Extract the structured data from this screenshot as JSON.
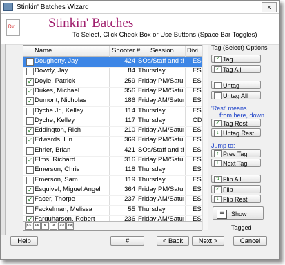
{
  "window": {
    "title": "Stinkin' Batches Wizard",
    "close": "x"
  },
  "header": {
    "logo_text": "Rur",
    "title": "Stinkin' Batches",
    "subtitle": "To Select, Click Check Box or Use Buttons  (Space Bar Toggles)"
  },
  "columns": {
    "name": "Name",
    "shooter": "Shooter #",
    "session": "Session",
    "division": "Divi"
  },
  "rows": [
    {
      "checked": false,
      "selected": true,
      "name": "Dougherty, Jay",
      "shooter": "424",
      "session": "SOs/Staff and th",
      "division": "ES"
    },
    {
      "checked": false,
      "selected": false,
      "name": "Dowdy, Jay",
      "shooter": "84",
      "session": "Thursday",
      "division": "ES"
    },
    {
      "checked": true,
      "selected": false,
      "name": "Doyle, Patrick",
      "shooter": "259",
      "session": "Friday PM/Saturd",
      "division": "ES"
    },
    {
      "checked": true,
      "selected": false,
      "name": "Dukes, Michael",
      "shooter": "356",
      "session": "Friday PM/Saturd",
      "division": "ES"
    },
    {
      "checked": true,
      "selected": false,
      "name": "Dumont, Nicholas",
      "shooter": "186",
      "session": "Friday AM/Saturd",
      "division": "ES"
    },
    {
      "checked": false,
      "selected": false,
      "name": "Dyche Jr., Kelley",
      "shooter": "114",
      "session": "Thursday",
      "division": "ES"
    },
    {
      "checked": false,
      "selected": false,
      "name": "Dyche, Kelley",
      "shooter": "117",
      "session": "Thursday",
      "division": "CD"
    },
    {
      "checked": true,
      "selected": false,
      "name": "Eddington, Rich",
      "shooter": "210",
      "session": "Friday AM/Saturd",
      "division": "ES"
    },
    {
      "checked": true,
      "selected": false,
      "name": "Edwards, Lin",
      "shooter": "369",
      "session": "Friday PM/Saturd",
      "division": "ES"
    },
    {
      "checked": false,
      "selected": false,
      "name": "Ehrler, Brian",
      "shooter": "421",
      "session": "SOs/Staff and th",
      "division": "ES"
    },
    {
      "checked": true,
      "selected": false,
      "name": "Elms, Richard",
      "shooter": "316",
      "division": "ES",
      "session": "Friday PM/Saturd"
    },
    {
      "checked": false,
      "selected": false,
      "name": "Emerson, Chris",
      "shooter": "118",
      "session": "Thursday",
      "division": "ES"
    },
    {
      "checked": false,
      "selected": false,
      "name": "Emerson, Sam",
      "shooter": "119",
      "session": "Thursday",
      "division": "ES"
    },
    {
      "checked": true,
      "selected": false,
      "name": "Esquivel, Miguel Angel",
      "shooter": "364",
      "session": "Friday PM/Saturd",
      "division": "ES"
    },
    {
      "checked": true,
      "selected": false,
      "name": "Facer, Thorpe",
      "shooter": "237",
      "session": "Friday AM/Saturd",
      "division": "ES"
    },
    {
      "checked": false,
      "selected": false,
      "name": "Fackelman, Melissa",
      "shooter": "55",
      "session": "Thursday",
      "division": "ES"
    },
    {
      "checked": true,
      "selected": false,
      "name": "Farquharson, Robert",
      "shooter": "236",
      "session": "Friday AM/Saturd",
      "division": "ES"
    }
  ],
  "nav_buttons": [
    "|<<",
    "<<",
    "<",
    ">",
    ">>",
    ">>|"
  ],
  "panel": {
    "tag_options_label": "Tag (Select) Options",
    "tag": "Tag",
    "tag_all": "Tag All",
    "untag": "Untag",
    "untag_all": "Untag All",
    "rest_label_1": "'Rest' means",
    "rest_label_2": "from here, down",
    "tag_rest": "Tag Rest",
    "untag_rest": "Untag Rest",
    "jump_label": "Jump to:",
    "prev_tag": "Prev Tag",
    "next_tag": "Next Tag",
    "flip_all": "Flip All",
    "flip": "Flip",
    "flip_rest": "Flip Rest",
    "show_tagged": "Show Tagged"
  },
  "footer": {
    "help": "Help",
    "hash": "#",
    "back": "< Back",
    "next": "Next >",
    "cancel": "Cancel"
  }
}
